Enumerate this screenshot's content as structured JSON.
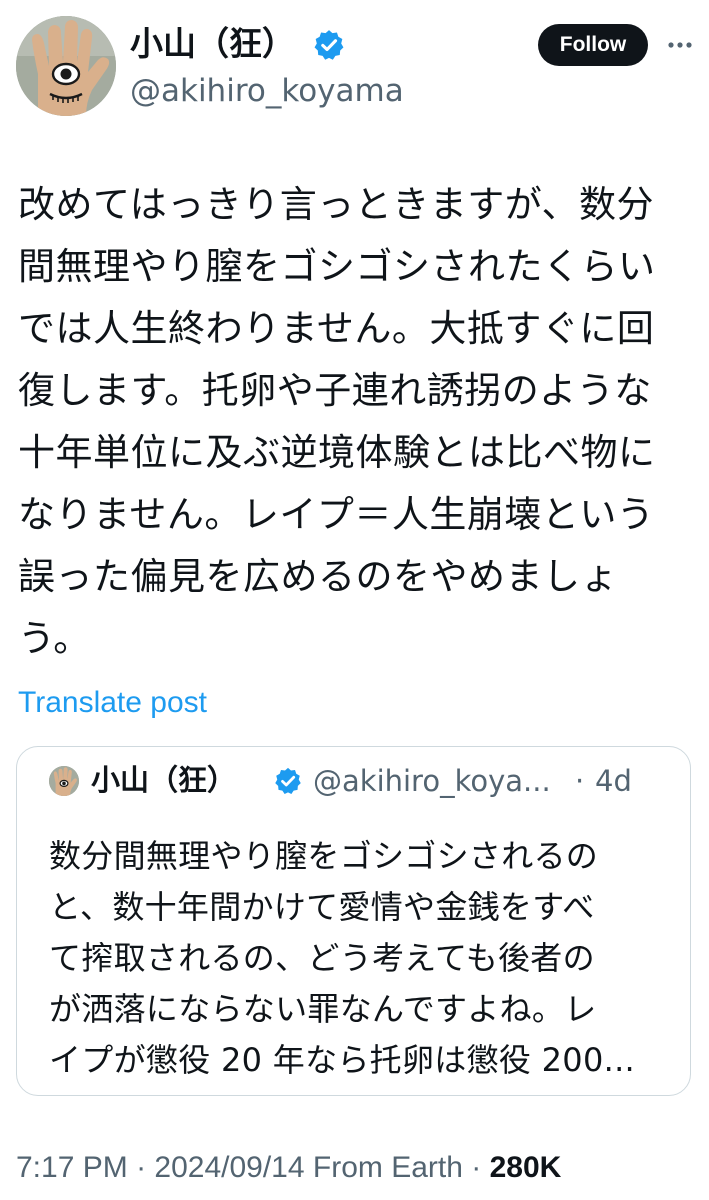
{
  "author": {
    "name": "小山（狂）",
    "handle": "@akihiro_koyama"
  },
  "follow_label": "Follow",
  "tweet_lines": [
    "改めてはっきり言っときますが、数分",
    "間無理やり膣をゴシゴシされたくらい",
    "では人生終わりません。大抵すぐに回",
    "復します。托卵や子連れ誘拐のような",
    "十年単位に及ぶ逆境体験とは比べ物に",
    "なりません。レイプ＝人生崩壊という",
    "誤った偏見を広めるのをやめましょ",
    "う。"
  ],
  "translate_label": "Translate post",
  "quote": {
    "name": "小山（狂）",
    "handle": "@akihiro_koya...",
    "separator": "·",
    "time": "4d",
    "lines": [
      "数分間無理やり膣をゴシゴシされるの",
      "と、数十年間かけて愛情や金銭をすべ",
      "て搾取されるの、どう考えても後者の",
      "が洒落にならない罪なんですよね。レ",
      "イプが懲役 20 年なら托卵は懲役 200..."
    ]
  },
  "meta": {
    "time": "7:17 PM",
    "sep1": " · ",
    "date": "2024/09/14",
    "source": " From Earth",
    "sep2": " · ",
    "views": "280K"
  },
  "icons": {
    "verified": "verified-badge-icon",
    "more": "more-options-icon",
    "avatar": "hand-eye-avatar"
  },
  "colors": {
    "accent": "#1d9bf0",
    "text": "#0f1419",
    "muted": "#536471",
    "border": "#cfd9de"
  }
}
